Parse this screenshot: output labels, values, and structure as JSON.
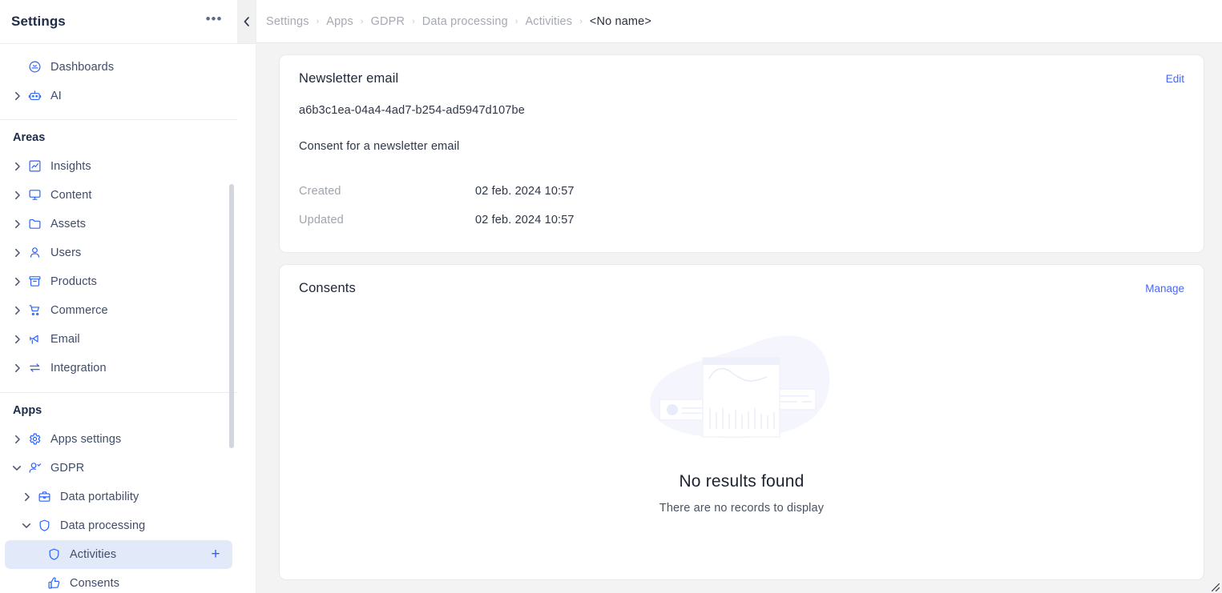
{
  "sidebar": {
    "title": "Settings",
    "more_label": "•••",
    "collapse_label": "‹",
    "top_items": [
      {
        "label": "Dashboards",
        "icon": "dashboard-icon",
        "expandable": false,
        "level": 0
      },
      {
        "label": "AI",
        "icon": "robot-icon",
        "expandable": true,
        "level": 0
      }
    ],
    "groups": [
      {
        "label": "Areas",
        "items": [
          {
            "label": "Insights",
            "icon": "chart-line-icon",
            "expandable": true,
            "level": 0
          },
          {
            "label": "Content",
            "icon": "monitor-icon",
            "expandable": true,
            "level": 0
          },
          {
            "label": "Assets",
            "icon": "folder-icon",
            "expandable": true,
            "level": 0
          },
          {
            "label": "Users",
            "icon": "user-icon",
            "expandable": true,
            "level": 0
          },
          {
            "label": "Products",
            "icon": "archive-icon",
            "expandable": true,
            "level": 0
          },
          {
            "label": "Commerce",
            "icon": "cart-icon",
            "expandable": true,
            "level": 0
          },
          {
            "label": "Email",
            "icon": "megaphone-icon",
            "expandable": true,
            "level": 0
          },
          {
            "label": "Integration",
            "icon": "exchange-icon",
            "expandable": true,
            "level": 0
          }
        ]
      },
      {
        "label": "Apps",
        "items": [
          {
            "label": "Apps settings",
            "icon": "gear-icon",
            "expandable": true,
            "level": 0
          },
          {
            "label": "GDPR",
            "icon": "user-check-icon",
            "expandable": true,
            "expanded": true,
            "level": 0
          },
          {
            "label": "Data portability",
            "icon": "briefcase-icon",
            "expandable": true,
            "level": 1
          },
          {
            "label": "Data processing",
            "icon": "shield-icon",
            "expandable": true,
            "expanded": true,
            "level": 1
          },
          {
            "label": "Activities",
            "icon": "shield-icon",
            "expandable": false,
            "level": 2,
            "active": true,
            "plus": "+"
          },
          {
            "label": "Consents",
            "icon": "thumbs-up-icon",
            "expandable": false,
            "level": 2
          }
        ]
      }
    ]
  },
  "breadcrumb": {
    "items": [
      "Settings",
      "Apps",
      "GDPR",
      "Data processing",
      "Activities",
      "<No name>"
    ],
    "separator": "›"
  },
  "detail_card": {
    "title": "Newsletter email",
    "action_label": "Edit",
    "uuid": "a6b3c1ea-04a4-4ad7-b254-ad5947d107be",
    "description": "Consent for a newsletter email",
    "meta": [
      {
        "key": "Created",
        "value": "02 feb. 2024 10:57"
      },
      {
        "key": "Updated",
        "value": "02 feb. 2024 10:57"
      }
    ]
  },
  "consents_card": {
    "title": "Consents",
    "action_label": "Manage",
    "empty": {
      "illustration": "empty-results-illustration",
      "title": "No results found",
      "subtitle": "There are no records to display"
    }
  },
  "colors": {
    "accent": "#2962ff",
    "link": "#4767f3",
    "active_nav_bg": "#e2e9f8",
    "page_bg": "#f3f3f4",
    "card_bg": "#ffffff",
    "border": "#e7e9ec",
    "muted_text": "#a0a4ad",
    "illustration_blob": "#f5f6fd",
    "illustration_line": "#eef0fb"
  }
}
